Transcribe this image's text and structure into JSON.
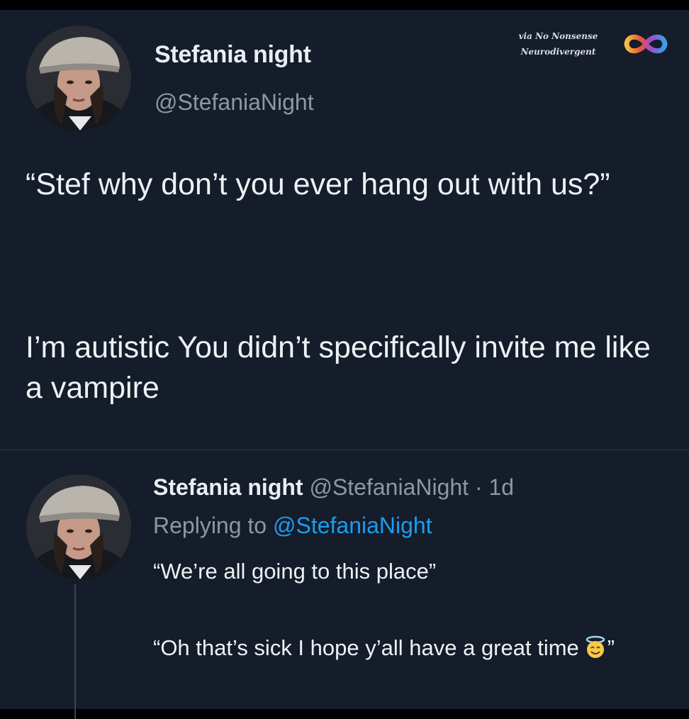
{
  "tweet": {
    "author_name": "Stefania night",
    "author_handle": "@StefaniaNight",
    "text_paragraph_1": "“Stef why don’t you ever hang out with us?”",
    "text_paragraph_2": "I’m autistic You didn’t specifically invite me like a vampire"
  },
  "watermark": {
    "line1": "via No Nonsense",
    "line2": "Neurodivergent",
    "icon": "infinity-logo"
  },
  "reply": {
    "author_name": "Stefania night",
    "author_meta": "@StefaniaNight · 1d",
    "replying_prefix": "Replying to",
    "replying_handle": "@StefaniaNight",
    "text_paragraph_1": "“We’re all going to this place”",
    "text_paragraph_2": "“Oh that’s sick I hope y’all have a great time",
    "text_suffix": "”",
    "emoji": "smiling-face-with-halo"
  },
  "colors": {
    "background": "#141d29",
    "primary_text": "#eef1f4",
    "secondary_text": "#8b98a5",
    "link": "#1d9bf0"
  }
}
